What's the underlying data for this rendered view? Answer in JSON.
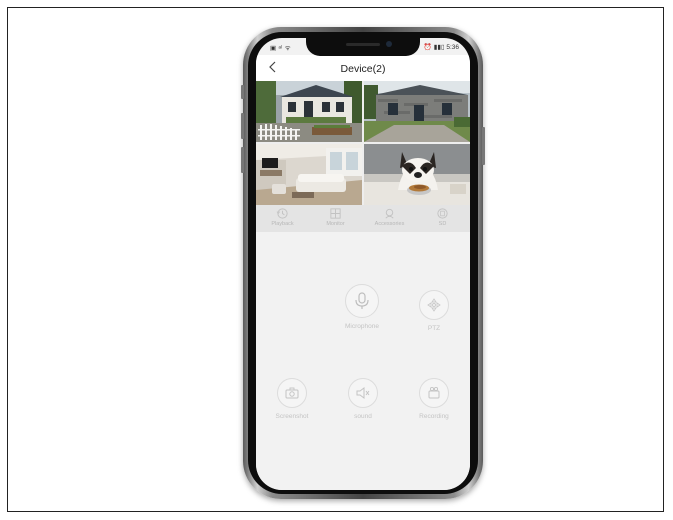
{
  "status_bar": {
    "left": "▣ ᵃˡ ᯤ",
    "right": "⏰ ▮▮▯ 5:36"
  },
  "header": {
    "title": "Device(2)"
  },
  "cameras": [
    {
      "id_label": "house-exterior"
    },
    {
      "id_label": "stone-cottage"
    },
    {
      "id_label": "living-room"
    },
    {
      "id_label": "dog"
    }
  ],
  "tabs": [
    {
      "label": "Playback",
      "icon": "playback-icon"
    },
    {
      "label": "Monitor",
      "icon": "grid-icon"
    },
    {
      "label": "Accessories",
      "icon": "accessories-icon"
    },
    {
      "label": "SD",
      "icon": "sd-icon"
    }
  ],
  "controls": {
    "microphone": "Microphone",
    "ptz": "PTZ",
    "screenshot": "Screenshot",
    "sound": "sound",
    "recording": "Recording"
  }
}
